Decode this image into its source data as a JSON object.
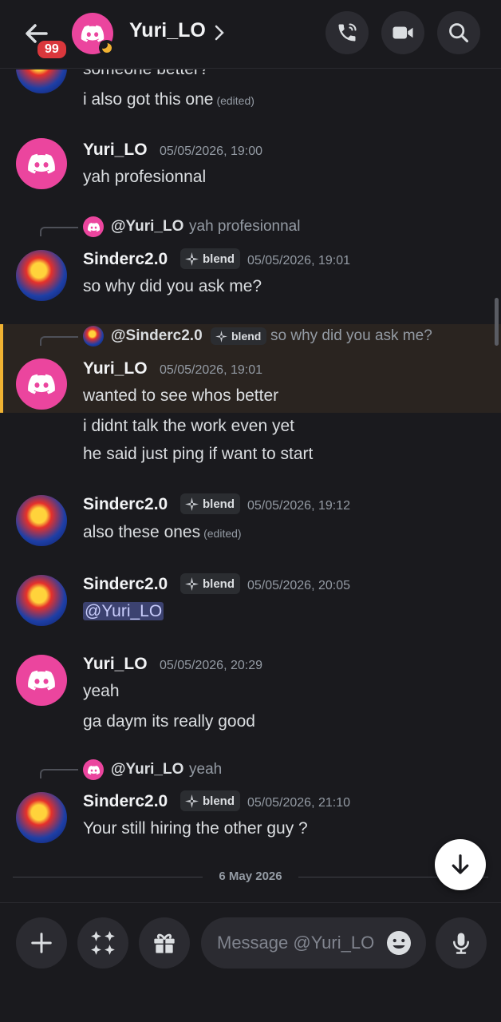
{
  "header": {
    "unread_badge": "99",
    "title": "Yuri_LO",
    "chevron": "›"
  },
  "messages": [
    {
      "partial_top_text": "someone better?",
      "text": "i also got this one",
      "edited": "(edited)"
    },
    {
      "username": "Yuri_LO",
      "timestamp": "05/05/2026, 19:00",
      "lines": [
        "yah profesionnal"
      ]
    },
    {
      "reply_to": "@Yuri_LO",
      "reply_text": "yah profesionnal",
      "username": "Sinderc2.0",
      "tag": "blend",
      "timestamp": "05/05/2026, 19:01",
      "lines": [
        "so why did you ask me?"
      ]
    },
    {
      "reply_to": "@Sinderc2.0",
      "reply_tag": "blend",
      "reply_text": "so why did you ask me?",
      "username": "Yuri_LO",
      "timestamp": "05/05/2026, 19:01",
      "lines": [
        "wanted to see whos better",
        "i didnt talk the work even yet",
        "he said just ping if want to start"
      ]
    },
    {
      "username": "Sinderc2.0",
      "tag": "blend",
      "timestamp": "05/05/2026, 19:12",
      "lines": [
        "also these ones"
      ],
      "edited": "(edited)"
    },
    {
      "username": "Sinderc2.0",
      "tag": "blend",
      "timestamp": "05/05/2026, 20:05",
      "mention": "@Yuri_LO"
    },
    {
      "username": "Yuri_LO",
      "timestamp": "05/05/2026, 20:29",
      "lines": [
        "yeah",
        "ga daym its really good"
      ]
    },
    {
      "reply_to": "@Yuri_LO",
      "reply_text": "yeah",
      "username": "Sinderc2.0",
      "tag": "blend",
      "timestamp": "05/05/2026, 21:10",
      "lines": [
        "Your still hiring the other guy ?"
      ]
    }
  ],
  "date_divider": "6 May 2026",
  "composer": {
    "placeholder": "Message @Yuri_LO"
  },
  "colors": {
    "background": "#1a1a1e",
    "avatar_pink": "#eb459e",
    "highlight_bar": "#f0b232",
    "badge_red": "#da373c",
    "mention_bg": "#3c4270"
  },
  "icons": [
    "back-arrow-icon",
    "discord-logo-icon",
    "moon-status-icon",
    "chevron-right-icon",
    "voice-call-icon",
    "video-call-icon",
    "search-icon",
    "sparkle-icon",
    "arrow-down-icon",
    "plus-icon",
    "apps-icon",
    "gift-icon",
    "emoji-icon",
    "microphone-icon"
  ]
}
